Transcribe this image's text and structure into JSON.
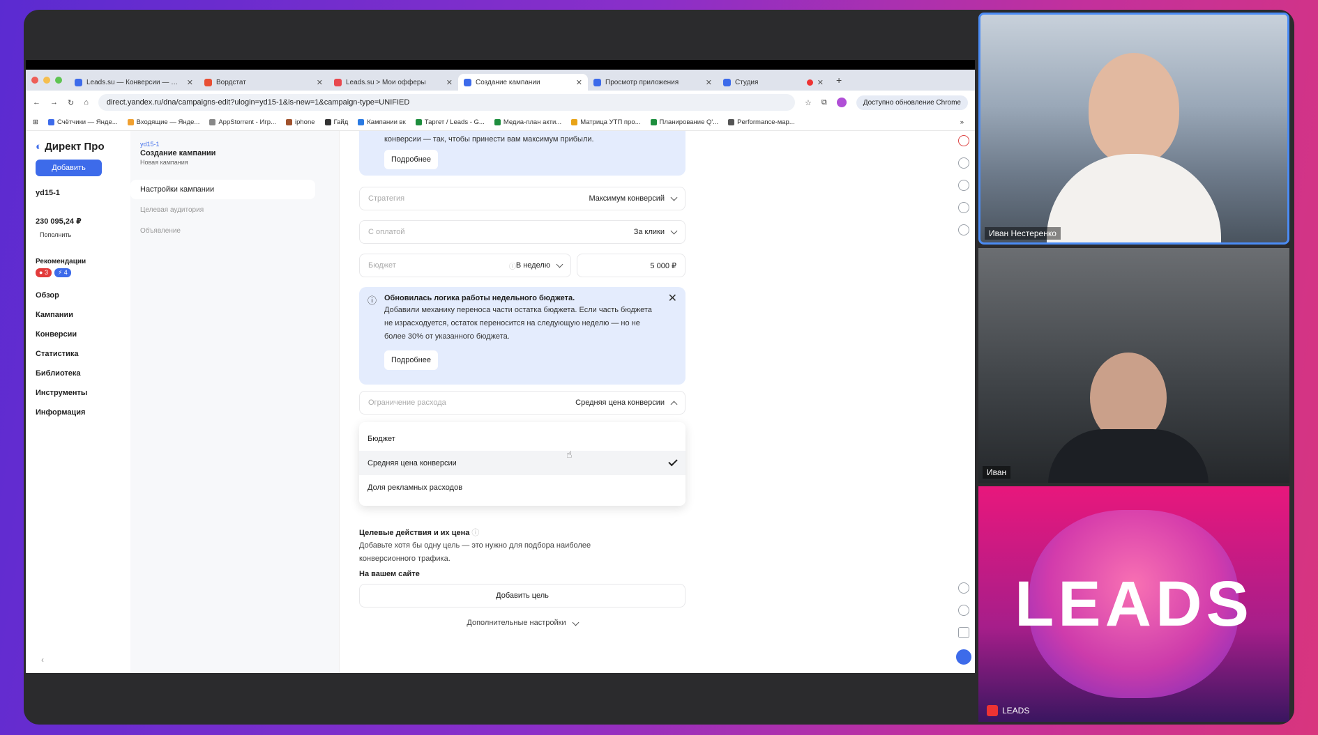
{
  "tabs": [
    {
      "label": "Leads.su — Конверсии — Ян...",
      "color": "#3d6bea",
      "active": false
    },
    {
      "label": "Вордстат",
      "color": "#e84f34",
      "active": false
    },
    {
      "label": "Leads.su > Мои офферы",
      "color": "#e8484e",
      "active": false
    },
    {
      "label": "Создание кампании",
      "color": "#3d6bea",
      "active": true
    },
    {
      "label": "Просмотр приложения",
      "color": "#3d6bea",
      "active": false
    },
    {
      "label": "Студия",
      "color": "#3d6bea",
      "active": false
    }
  ],
  "address": {
    "url": "direct.yandex.ru/dna/campaigns-edit?ulogin=yd15-1&is-new=1&campaign-type=UNIFIED",
    "update_label": "Доступно обновление Chrome"
  },
  "bookmarks": [
    "Счётчики — Янде...",
    "Входящие — Янде...",
    "AppStorrent - Игр...",
    "iphone",
    "Гайд",
    "Кампании вк",
    "Таргет / Leads - G...",
    "Медиа-план акти...",
    "Матрица УТП про...",
    "Планирование Q'...",
    "Performance-мар..."
  ],
  "leftnav": {
    "logo": "Директ Про",
    "add_label": "Добавить",
    "account": "yd15-1",
    "balance": "230 095,24 ₽",
    "topup": "Пополнить",
    "recs_label": "Рекомендации",
    "badge_red": "3",
    "badge_blue": "4",
    "items": [
      "Обзор",
      "Кампании",
      "Конверсии",
      "Статистика",
      "Библиотека",
      "Инструменты",
      "Информация"
    ]
  },
  "campnav": {
    "crumb": "yd15-1",
    "title": "Создание кампании",
    "subtitle": "Новая кампания",
    "active": "Настройки кампании",
    "items": [
      "Целевая аудитория",
      "Объявление"
    ]
  },
  "main": {
    "top_info_text": "конверсии — так, чтобы принести вам максимум прибыли.",
    "more_label": "Подробнее",
    "strategy_label": "Стратегия",
    "strategy_value": "Максимум конверсий",
    "payment_label": "С оплатой",
    "payment_value": "За клики",
    "budget_label": "Бюджет",
    "budget_period": "В неделю",
    "budget_amount": "5 000 ₽",
    "notice_title": "Обновилась логика работы недельного бюджета.",
    "notice_text": "Добавили механику переноса части остатка бюджета. Если часть бюджета не израсходуется, остаток переносится на следующую неделю — но не более 30% от указанного бюджета.",
    "limit_label": "Ограничение расхода",
    "limit_value": "Средняя цена конверсии",
    "options": [
      "Бюджет",
      "Средняя цена конверсии",
      "Доля рекламных расходов"
    ],
    "goals_title": "Целевые действия и их цена",
    "goals_text": "Добавьте хотя бы одну цель — это нужно для подбора наиболее конверсионного трафика.",
    "on_site": "На вашем сайте",
    "add_goal": "Добавить цель",
    "extra_settings": "Дополнительные настройки"
  },
  "participants": {
    "p1": "Иван Нестеренко",
    "p2": "Иван",
    "p3": "LEADS",
    "logo_text": "LEADS"
  }
}
